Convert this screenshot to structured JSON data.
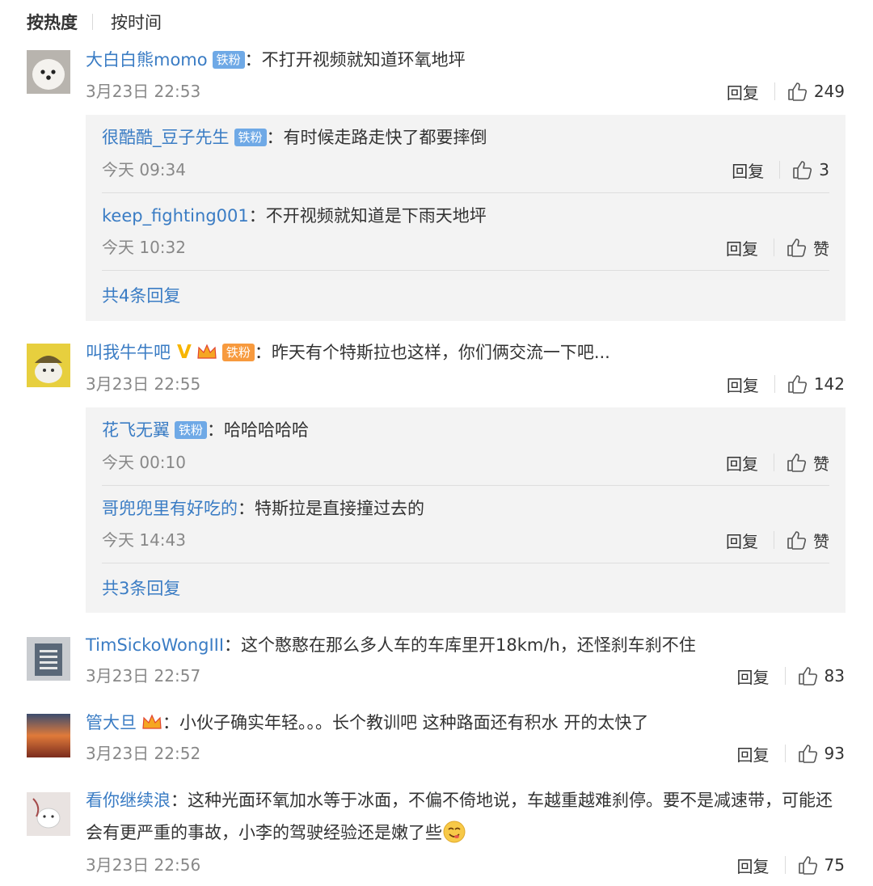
{
  "sort": {
    "hot": "按热度",
    "time": "按时间"
  },
  "comments": [
    {
      "user": "大白白熊momo",
      "badge": "铁粉",
      "text": "不打开视频就知道环氧地坪",
      "time": "3月23日 22:53",
      "reply": "回复",
      "likes": "249",
      "subs": [
        {
          "user": "很酷酷_豆子先生",
          "badge": "铁粉",
          "text": "有时候走路走快了都要摔倒",
          "time": "今天 09:34",
          "reply": "回复",
          "likes": "3"
        },
        {
          "user": "keep_fighting001",
          "text": "不开视频就知道是下雨天地坪",
          "time": "今天 10:32",
          "reply": "回复",
          "likes": "赞"
        }
      ],
      "more": "共4条回复"
    },
    {
      "user": "叫我牛牛吧",
      "badge": "铁粉",
      "text": "昨天有个特斯拉也这样，你们俩交流一下吧...",
      "time": "3月23日 22:55",
      "reply": "回复",
      "likes": "142",
      "subs": [
        {
          "user": "花飞无翼",
          "badge": "铁粉",
          "text": "哈哈哈哈哈",
          "time": "今天 00:10",
          "reply": "回复",
          "likes": "赞"
        },
        {
          "user": "哥兜兜里有好吃的",
          "text": "特斯拉是直接撞过去的",
          "time": "今天 14:43",
          "reply": "回复",
          "likes": "赞"
        }
      ],
      "more": "共3条回复"
    },
    {
      "user": "TimSickoWongIII",
      "text": "这个憨憨在那么多人车的车库里开18km/h，还怪刹车刹不住",
      "time": "3月23日 22:57",
      "reply": "回复",
      "likes": "83"
    },
    {
      "user": "管大旦",
      "text": "小伙子确实年轻。。。长个教训吧 这种路面还有积水 开的太快了",
      "time": "3月23日 22:52",
      "reply": "回复",
      "likes": "93"
    },
    {
      "user": "看你继续浪",
      "text": "这种光面环氧加水等于冰面，不偏不倚地说，车越重越难刹停。要不是减速带，可能还会有更严重的事故，小李的驾驶经验还是嫩了些",
      "time": "3月23日 22:56",
      "reply": "回复",
      "likes": "75"
    }
  ],
  "colon": "：",
  "colors": {
    "username": "#3a7cc4",
    "badge": "#6fa9e6",
    "subbox": "#f3f3f3",
    "vip": "#f7b500"
  },
  "icons": {
    "like": "thumbs-up-icon",
    "verified": "verified-v-icon",
    "fan": "crown-icon",
    "emoji": "yummy-face-emoji"
  }
}
